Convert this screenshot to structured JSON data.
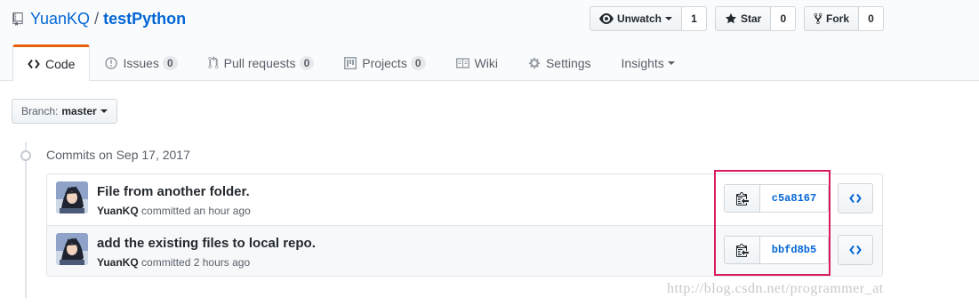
{
  "repo": {
    "owner": "YuanKQ",
    "separator": "/",
    "name": "testPython"
  },
  "actions": [
    {
      "label": "Unwatch",
      "icon": "eye-icon",
      "count": "1"
    },
    {
      "label": "Star",
      "icon": "star-icon",
      "count": "0"
    },
    {
      "label": "Fork",
      "icon": "fork-icon",
      "count": "0"
    }
  ],
  "tabs": [
    {
      "label": "Code",
      "icon": "code-icon",
      "selected": true
    },
    {
      "label": "Issues",
      "icon": "issue-icon",
      "count": "0"
    },
    {
      "label": "Pull requests",
      "icon": "pull-request-icon",
      "count": "0"
    },
    {
      "label": "Projects",
      "icon": "project-icon",
      "count": "0"
    },
    {
      "label": "Wiki",
      "icon": "book-icon"
    },
    {
      "label": "Settings",
      "icon": "gear-icon"
    },
    {
      "label": "Insights",
      "icon": "chevron-down-icon"
    }
  ],
  "branch": {
    "label": "Branch:",
    "value": "master"
  },
  "commits_heading": "Commits on Sep 17, 2017",
  "commits": [
    {
      "message": "File from another folder.",
      "author": "YuanKQ",
      "verb": "committed",
      "time": "an hour ago",
      "sha": "c5a8167"
    },
    {
      "message": "add the existing files to local repo.",
      "author": "YuanKQ",
      "verb": "committed",
      "time": "2 hours ago",
      "sha": "bbfd8b5"
    }
  ],
  "watermark": "http://blog.csdn.net/programmer_at",
  "colors": {
    "link": "#0366d6",
    "selected_tab_accent": "#e36209",
    "highlight": "#d81b60"
  }
}
